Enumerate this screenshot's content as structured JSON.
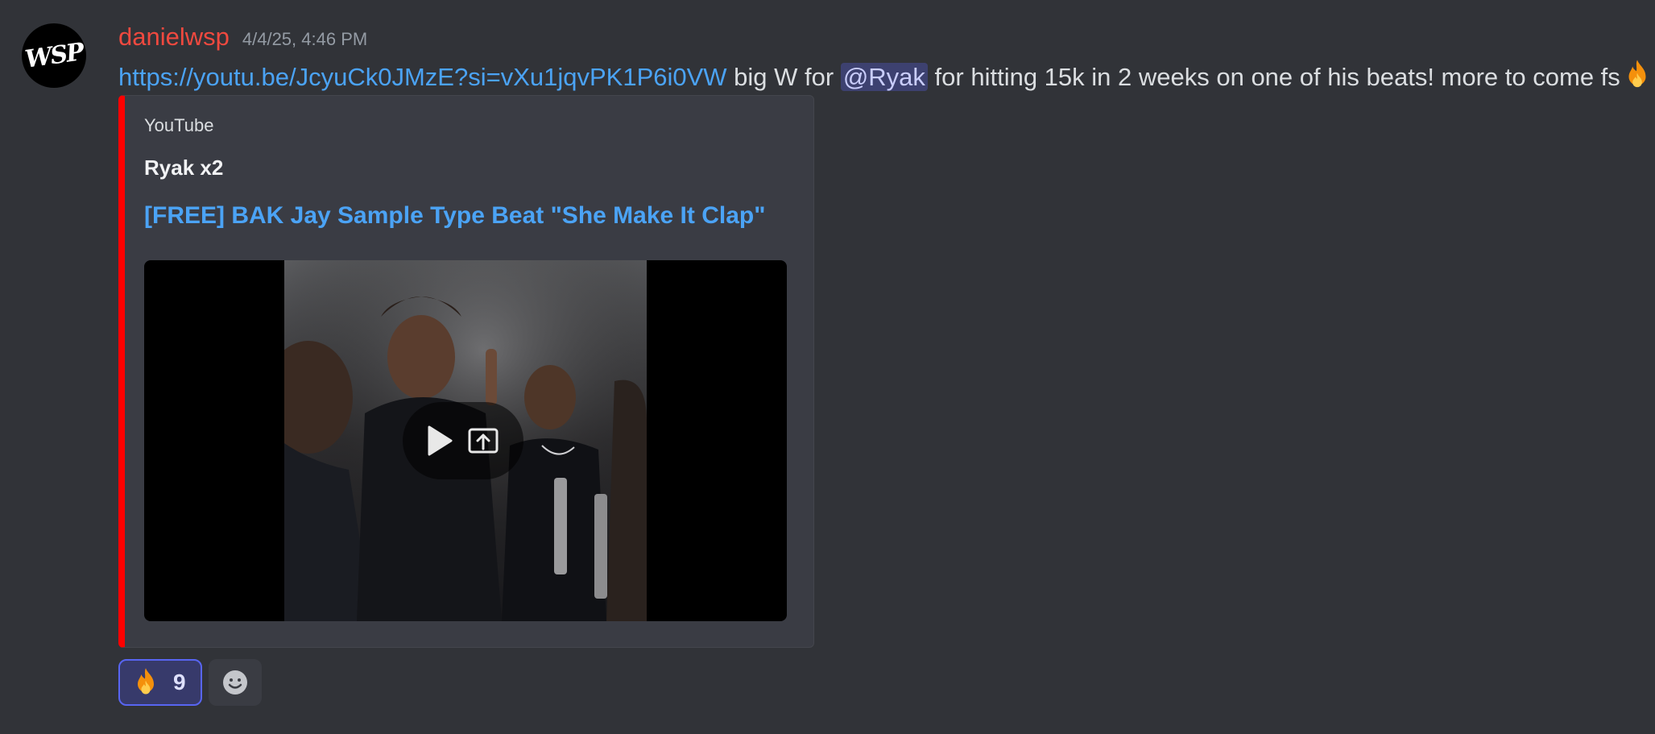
{
  "message": {
    "author": "danielwsp",
    "avatar_text": "WSP",
    "timestamp": "4/4/25, 4:46 PM",
    "link": "https://youtu.be/JcyuCk0JMzE?si=vXu1jqvPK1P6i0VW",
    "text_before_mention": " big W for ",
    "mention": "@Ryak",
    "text_after_mention": " for hitting 15k in 2 weeks on one of his beats! more to come fs",
    "trailing_emoji": "fire-icon"
  },
  "embed": {
    "accent_color": "#ff0000",
    "provider": "YouTube",
    "author": "Ryak x2",
    "title": "[FREE] BAK Jay Sample Type Beat \"She Make It Clap\""
  },
  "reactions": [
    {
      "emoji": "fire-icon",
      "count": "9",
      "active": true
    },
    {
      "emoji": "add-reaction-icon"
    }
  ],
  "colors": {
    "background": "#313338",
    "username": "#f0493f",
    "link": "#4ba3f5",
    "mention_bg": "#3c4270"
  }
}
